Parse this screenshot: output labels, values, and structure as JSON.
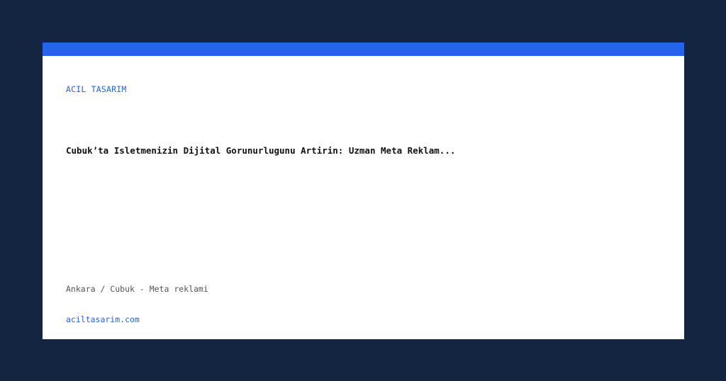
{
  "brand": {
    "name": "ACIL TASARIM",
    "accent_color": "#2563eb",
    "background_color": "#132541"
  },
  "article": {
    "headline": "Cubuk’ta Isletmenizin Dijital Gorunurlugunu Artirin: Uzman Meta Reklam...",
    "location_line": "Ankara / Cubuk - Meta reklami"
  },
  "footer": {
    "site": "aciltasarim.com"
  }
}
